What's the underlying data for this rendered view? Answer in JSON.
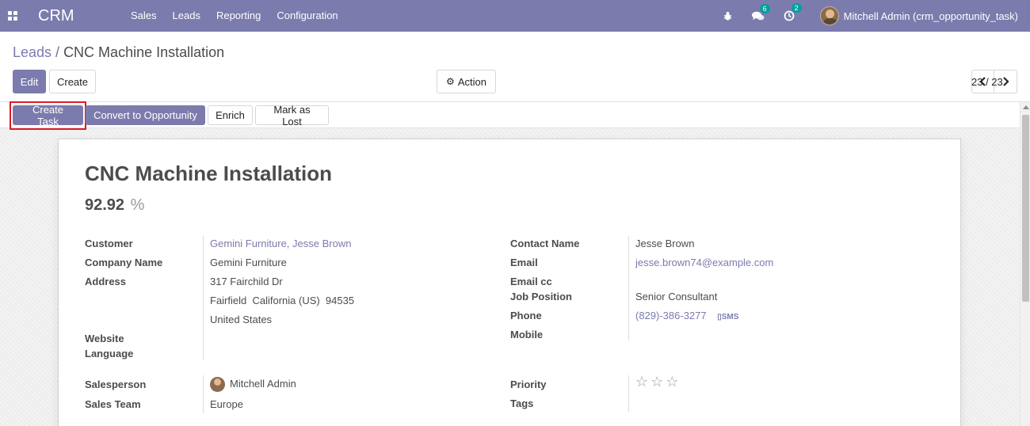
{
  "navbar": {
    "brand": "CRM",
    "menu": [
      "Sales",
      "Leads",
      "Reporting",
      "Configuration"
    ],
    "messages_count": "6",
    "activities_count": "2",
    "user": "Mitchell Admin (crm_opportunity_task)"
  },
  "breadcrumb": {
    "parent": "Leads",
    "separator": "/",
    "current": "CNC Machine Installation"
  },
  "toolbar": {
    "edit_label": "Edit",
    "create_label": "Create",
    "action_label": "Action",
    "pager_value": "23 / 23"
  },
  "statusbar": {
    "create_task": "Create Task",
    "convert": "Convert to Opportunity",
    "enrich": "Enrich",
    "mark_lost": "Mark as Lost"
  },
  "form": {
    "title": "CNC Machine Installation",
    "probability": "92.92",
    "probability_unit": "%",
    "left": {
      "customer_label": "Customer",
      "customer_value": "Gemini Furniture, Jesse Brown",
      "company_label": "Company Name",
      "company_value": "Gemini Furniture",
      "address_label": "Address",
      "street": "317 Fairchild Dr",
      "city_line": "Fairfield  California (US)  94535",
      "country": "United States",
      "website_label": "Website",
      "language_label": "Language",
      "salesperson_label": "Salesperson",
      "salesperson_value": "Mitchell Admin",
      "team_label": "Sales Team",
      "team_value": "Europe"
    },
    "right": {
      "contact_label": "Contact Name",
      "contact_value": "Jesse Brown",
      "email_label": "Email",
      "email_value": "jesse.brown74@example.com",
      "email_cc_label": "Email cc",
      "job_label": "Job Position",
      "job_value": "Senior Consultant",
      "phone_label": "Phone",
      "phone_value": "(829)-386-3277",
      "sms_label": "SMS",
      "mobile_label": "Mobile",
      "priority_label": "Priority",
      "priority_stars": "☆☆☆",
      "tags_label": "Tags"
    }
  },
  "colors": {
    "primary": "#7c7bad",
    "badge": "#00a09d",
    "highlight": "#e01b24"
  }
}
